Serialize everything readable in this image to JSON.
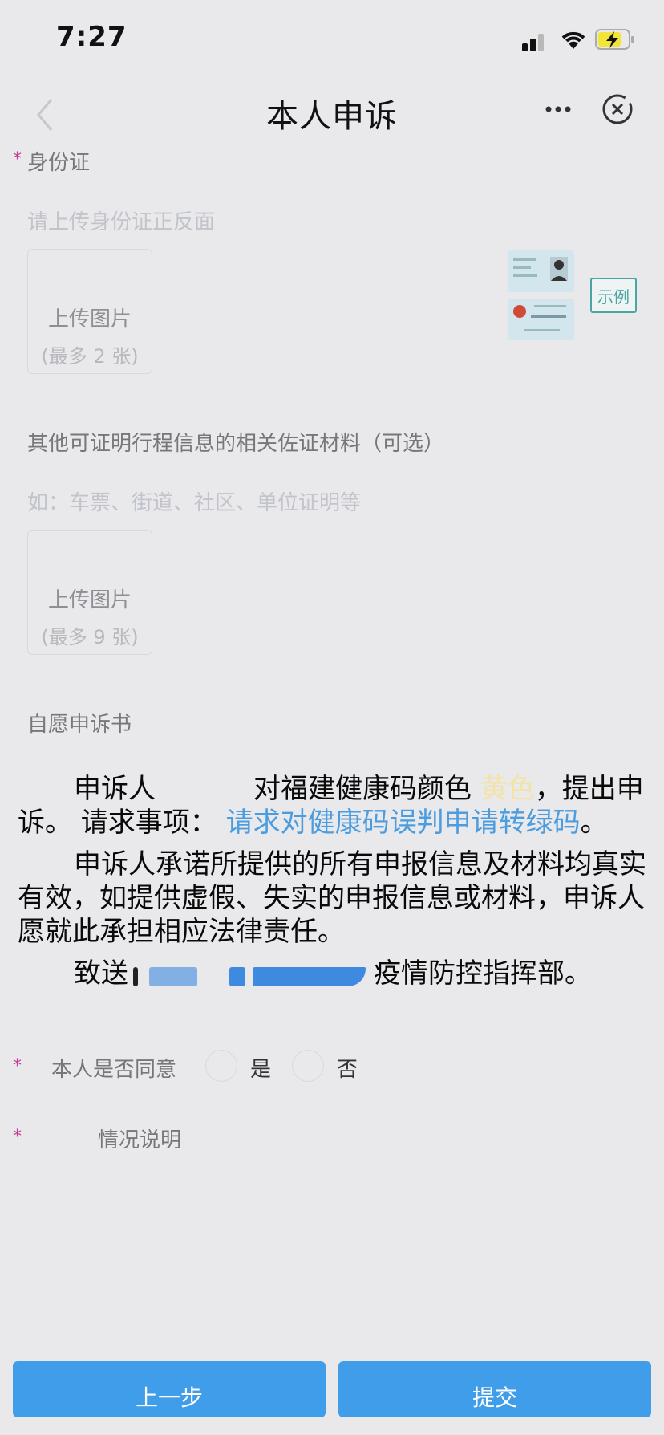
{
  "status": {
    "time": "7:27"
  },
  "nav": {
    "title": "本人申诉"
  },
  "id_section": {
    "label": "身份证",
    "required_mark": "*",
    "hint": "请上传身份证正反面",
    "upload_label": "上传图片",
    "upload_limit": "(最多 2 张)",
    "example_label": "示例"
  },
  "evidence_section": {
    "label": "其他可证明行程信息的相关佐证材料（可选）",
    "hint": "如：车票、街道、社区、单位证明等",
    "upload_label": "上传图片",
    "upload_limit": "(最多 9 张)"
  },
  "letter": {
    "heading": "自愿申诉书",
    "p1_a": "申诉人",
    "p1_b": "对福建健康码颜色",
    "p1_color": "黄色",
    "p1_c": "，提出申诉。 请求事项：",
    "p1_request": "请求对健康码误判申请转绿码",
    "p1_end": "。",
    "p2": "申诉人承诺所提供的所有申报信息及材料均真实有效，如提供虚假、失实的申报信息或材料，申诉人愿就此承担相应法律责任。",
    "p3_a": "致送",
    "p3_b": "疫情防控指挥部。"
  },
  "consent": {
    "required_mark": "*",
    "label": "本人是否同意",
    "yes": "是",
    "no": "否"
  },
  "explain": {
    "required_mark": "*",
    "label": "情况说明"
  },
  "footer": {
    "prev": "上一步",
    "submit": "提交"
  }
}
